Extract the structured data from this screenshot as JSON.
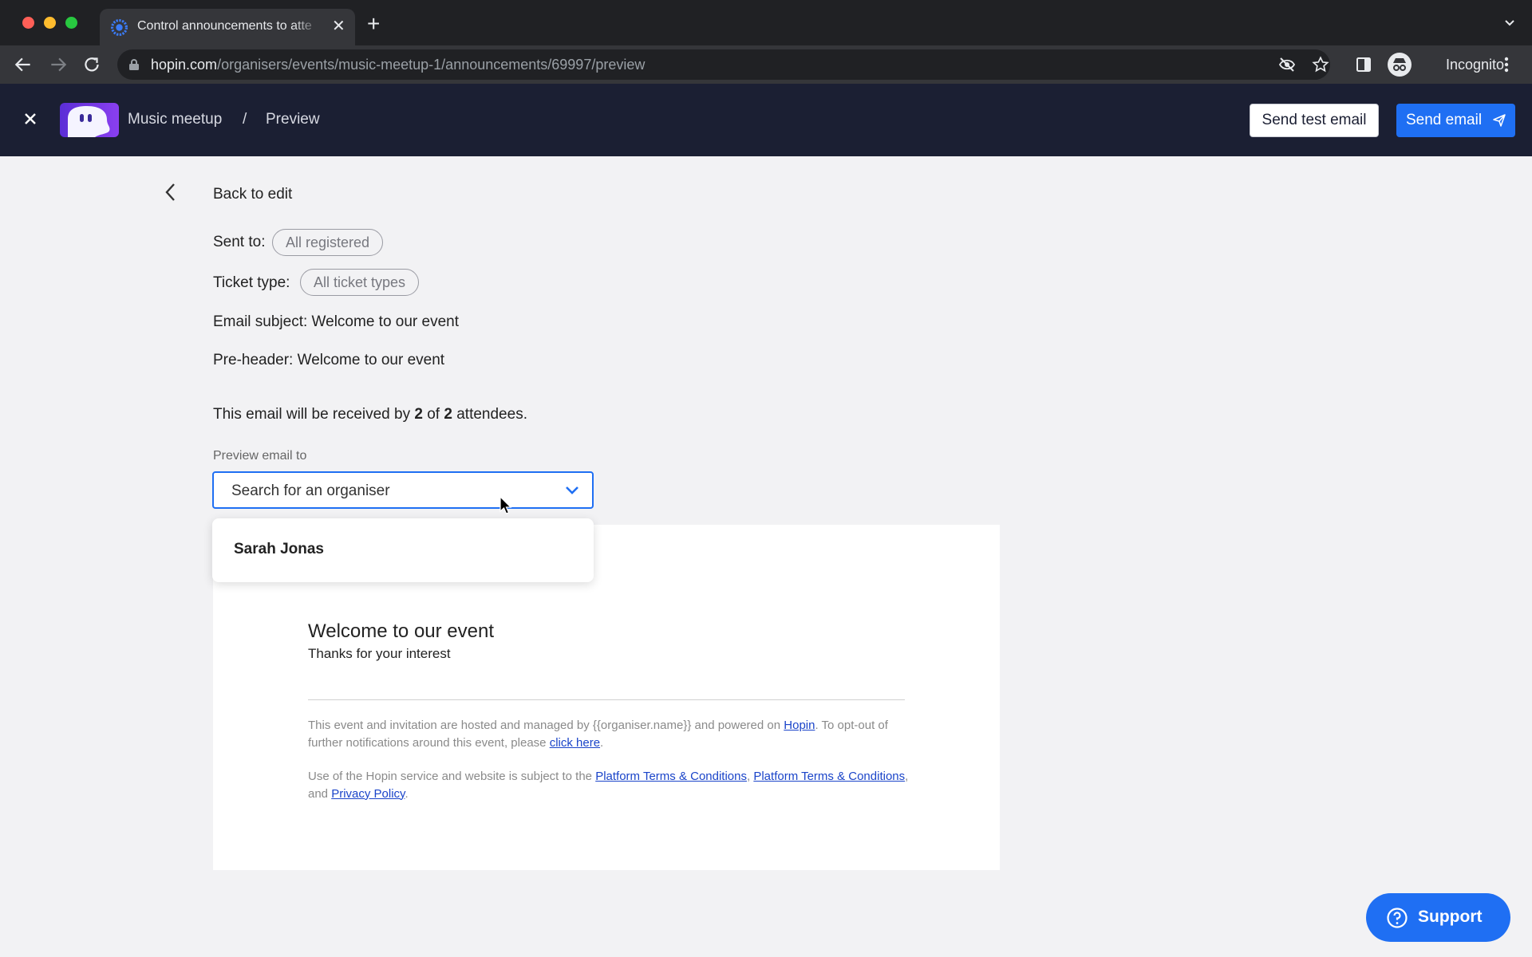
{
  "browser": {
    "tab_title": "Control announcements to atte",
    "url_host": "hopin.com",
    "url_path": "/organisers/events/music-meetup-1/announcements/69997/preview",
    "profile_label": "Incognito"
  },
  "header": {
    "event_name": "Music meetup",
    "separator": "/",
    "page": "Preview",
    "send_test_label": "Send test email",
    "send_label": "Send email"
  },
  "content": {
    "back_label": "Back to edit",
    "sent_to_label": "Sent to:",
    "sent_to_value": "All registered",
    "ticket_type_label": "Ticket type:",
    "ticket_type_value": "All ticket types",
    "email_subject": "Email subject: Welcome to our event",
    "pre_header": "Pre-header: Welcome to our event",
    "receive_prefix": "This email will be received by",
    "receive_count": "2",
    "receive_of": "of",
    "receive_total": "2",
    "receive_suffix": "attendees.",
    "preview_label": "Preview email to",
    "preview_placeholder": "Search for an organiser",
    "dropdown_options": [
      "Sarah Jonas"
    ]
  },
  "email": {
    "title": "Welcome to our event",
    "subtitle": "Thanks for your interest",
    "footer1_pre": "This event and invitation are hosted and managed by {{organiser.name}} and powered on",
    "footer1_link1": "Hopin",
    "footer1_mid": ". To opt-out of further notifications around this event, please",
    "footer1_link2": "click here",
    "footer1_end": ".",
    "footer2_pre": "Use of the Hopin service and website is subject to the",
    "footer2_link1": "Platform Terms & Conditions",
    "footer2_sep": ",",
    "footer2_link2": "Platform Terms & Conditions",
    "footer2_and": ", and",
    "footer2_link3": "Privacy Policy",
    "footer2_end": "."
  },
  "support_label": "Support",
  "colors": {
    "accent": "#1f6ff3",
    "header_bg": "#1b1f33",
    "page_bg": "#f2f2f4"
  }
}
